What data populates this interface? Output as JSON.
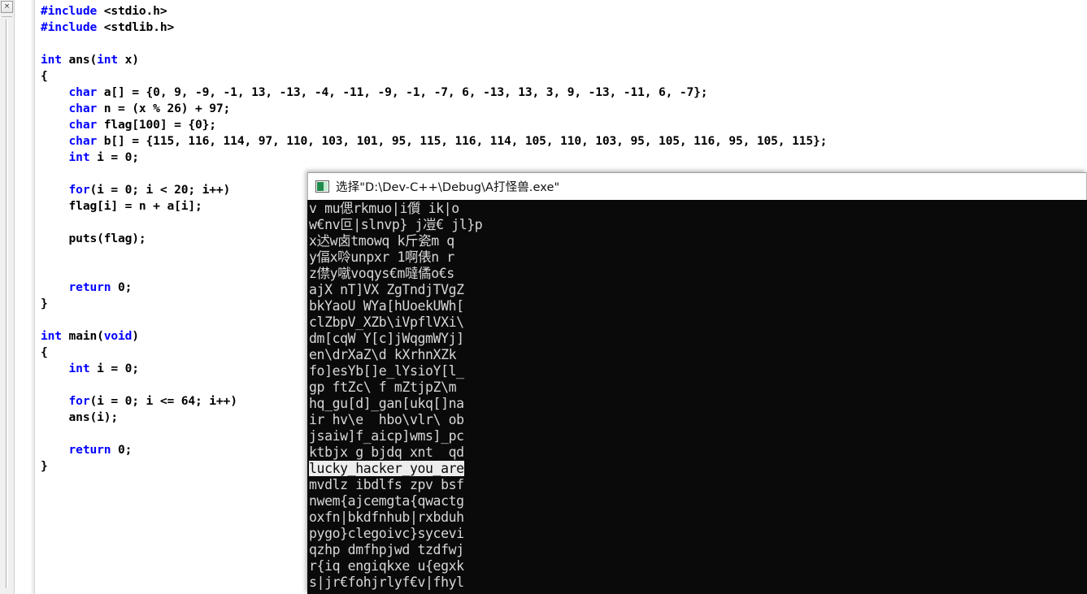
{
  "window": {
    "app": "Dev-C++ IDE with console output"
  },
  "left_dock": {
    "close_icon": "×",
    "close_label": "Close panel"
  },
  "editor": {
    "language": "c",
    "code_lines": [
      {
        "indent": 0,
        "tokens": [
          {
            "t": "#include",
            "c": "pp"
          },
          {
            "t": " <stdio.h>",
            "c": "pl"
          }
        ]
      },
      {
        "indent": 0,
        "tokens": [
          {
            "t": "#include",
            "c": "pp"
          },
          {
            "t": " <stdlib.h>",
            "c": "pl"
          }
        ]
      },
      {
        "indent": 0,
        "tokens": []
      },
      {
        "indent": 0,
        "tokens": [
          {
            "t": "int",
            "c": "kw"
          },
          {
            "t": " ans(",
            "c": "pl"
          },
          {
            "t": "int",
            "c": "kw"
          },
          {
            "t": " x)",
            "c": "pl"
          }
        ]
      },
      {
        "indent": 0,
        "tokens": [
          {
            "t": "{",
            "c": "pl"
          }
        ]
      },
      {
        "indent": 4,
        "tokens": [
          {
            "t": "char",
            "c": "kw"
          },
          {
            "t": " a[] = {0, 9, -9, -1, 13, -13, -4, -11, -9, -1, -7, 6, -13, 13, 3, 9, -13, -11, 6, -7};",
            "c": "pl"
          }
        ]
      },
      {
        "indent": 4,
        "tokens": [
          {
            "t": "char",
            "c": "kw"
          },
          {
            "t": " n = (x % 26) + 97;",
            "c": "pl"
          }
        ]
      },
      {
        "indent": 4,
        "tokens": [
          {
            "t": "char",
            "c": "kw"
          },
          {
            "t": " flag[100] = {0};",
            "c": "pl"
          }
        ]
      },
      {
        "indent": 4,
        "tokens": [
          {
            "t": "char",
            "c": "kw"
          },
          {
            "t": " b[] = {115, 116, 114, 97, 110, 103, 101, 95, 115, 116, 114, 105, 110, 103, 95, 105, 116, 95, 105, 115};",
            "c": "pl"
          }
        ]
      },
      {
        "indent": 4,
        "tokens": [
          {
            "t": "int",
            "c": "kw"
          },
          {
            "t": " i = 0;",
            "c": "pl"
          }
        ]
      },
      {
        "indent": 0,
        "tokens": []
      },
      {
        "indent": 4,
        "tokens": [
          {
            "t": "for",
            "c": "kw"
          },
          {
            "t": "(i = 0; i < 20; i++)",
            "c": "pl"
          }
        ]
      },
      {
        "indent": 4,
        "tokens": [
          {
            "t": "flag[i] = n + a[i];",
            "c": "pl"
          }
        ]
      },
      {
        "indent": 0,
        "tokens": []
      },
      {
        "indent": 4,
        "tokens": [
          {
            "t": "puts(flag);",
            "c": "pl"
          }
        ]
      },
      {
        "indent": 0,
        "tokens": []
      },
      {
        "indent": 0,
        "tokens": []
      },
      {
        "indent": 4,
        "tokens": [
          {
            "t": "return",
            "c": "kw"
          },
          {
            "t": " 0;",
            "c": "pl"
          }
        ]
      },
      {
        "indent": 0,
        "tokens": [
          {
            "t": "}",
            "c": "pl"
          }
        ]
      },
      {
        "indent": 0,
        "tokens": []
      },
      {
        "indent": 0,
        "tokens": [
          {
            "t": "int",
            "c": "kw"
          },
          {
            "t": " main(",
            "c": "pl"
          },
          {
            "t": "void",
            "c": "kw"
          },
          {
            "t": ")",
            "c": "pl"
          }
        ]
      },
      {
        "indent": 0,
        "tokens": [
          {
            "t": "{",
            "c": "pl"
          }
        ]
      },
      {
        "indent": 4,
        "tokens": [
          {
            "t": "int",
            "c": "kw"
          },
          {
            "t": " i = 0;",
            "c": "pl"
          }
        ]
      },
      {
        "indent": 0,
        "tokens": []
      },
      {
        "indent": 4,
        "tokens": [
          {
            "t": "for",
            "c": "kw"
          },
          {
            "t": "(i = 0; i <= 64; i++)",
            "c": "pl"
          }
        ]
      },
      {
        "indent": 4,
        "tokens": [
          {
            "t": "ans(i);",
            "c": "pl"
          }
        ]
      },
      {
        "indent": 0,
        "tokens": []
      },
      {
        "indent": 4,
        "tokens": [
          {
            "t": "return",
            "c": "kw"
          },
          {
            "t": " 0;",
            "c": "pl"
          }
        ]
      },
      {
        "indent": 0,
        "tokens": [
          {
            "t": "}",
            "c": "pl"
          }
        ]
      }
    ]
  },
  "console": {
    "title": "选择\"D:\\Dev-C++\\Debug\\A打怪兽.exe\"",
    "icon": "console-window-icon",
    "background_color": "#0a0a0a",
    "text_color": "#d8d8d8",
    "selection_background": "#ededed",
    "selection_text_color": "#0a0a0a",
    "lines": [
      {
        "text": "v mu偲rkmuo|i儨 ik|o",
        "selected": false
      },
      {
        "text": "w€nv叵|slnvp} j凒€ jl}p",
        "selected": false
      },
      {
        "text": "x迖w卤tmowq k斤瓷m q",
        "selected": false
      },
      {
        "text": "y偪x唥unpxr 1啊俵n r",
        "selected": false
      },
      {
        "text": "z僸y噈voqys€m噠僪o€s",
        "selected": false
      },
      {
        "text": "ajX nT]VX ZgTndjTVgZ",
        "selected": false
      },
      {
        "text": "bkYaoU WYa[hUoekUWh[",
        "selected": false
      },
      {
        "text": "clZbpV_XZb\\iVpflVXi\\",
        "selected": false
      },
      {
        "text": "dm[cqW Y[c]jWqgmWYj]",
        "selected": false
      },
      {
        "text": "en\\drXaZ\\d kXrhnXZk",
        "selected": false
      },
      {
        "text": "fo]esYb[]e_lYsioY[l_",
        "selected": false
      },
      {
        "text": "gp ftZc\\ f mZtjpZ\\m",
        "selected": false
      },
      {
        "text": "hq_gu[d]_gan[ukq[]na",
        "selected": false
      },
      {
        "text": "ir hv\\e  hbo\\vlr\\ ob",
        "selected": false
      },
      {
        "text": "jsaiw]f_aicp]wms]_pc",
        "selected": false
      },
      {
        "text": "ktbjx g bjdq xnt  qd",
        "selected": false
      },
      {
        "text": "lucky_hacker_you_are",
        "selected": true
      },
      {
        "text": "mvdlz ibdlfs zpv bsf",
        "selected": false
      },
      {
        "text": "nwem{ajcemgta{qwactg",
        "selected": false
      },
      {
        "text": "oxfn|bkdfnhub|rxbduh",
        "selected": false
      },
      {
        "text": "pygo}clegoivc}sycevi",
        "selected": false
      },
      {
        "text": "qzhp dmfhpjwd tzdfwj",
        "selected": false
      },
      {
        "text": "r{iq engiqkxe u{egxk",
        "selected": false
      },
      {
        "text": "s|jr€fohjrlyf€v|fhyl",
        "selected": false
      }
    ]
  }
}
